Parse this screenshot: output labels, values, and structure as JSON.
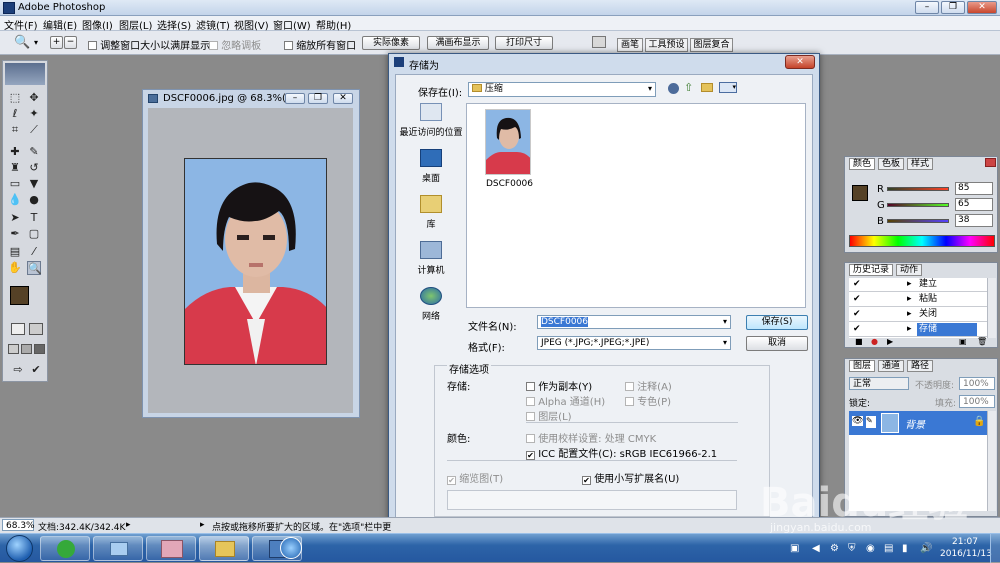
{
  "app": {
    "title": "Adobe Photoshop"
  },
  "menu": [
    "文件(F)",
    "编辑(E)",
    "图像(I)",
    "图层(L)",
    "选择(S)",
    "滤镜(T)",
    "视图(V)",
    "窗口(W)",
    "帮助(H)"
  ],
  "options": {
    "resize_windows": "调整窗口大小以满屏显示",
    "ignore_palettes": "忽略调板",
    "zoom_all": "缩放所有窗口",
    "actual_pixels": "实际像素",
    "fit_screen": "满画布显示",
    "print_size": "打印尺寸",
    "tabs": [
      "画笔",
      "工具预设",
      "图层复合"
    ]
  },
  "document": {
    "title": "DSCF0006.jpg @ 68.3%(R..."
  },
  "dialog": {
    "title": "存储为",
    "save_in_label": "保存在(I):",
    "save_in_value": "压缩",
    "places": [
      "最近访问的位置",
      "桌面",
      "库",
      "计算机",
      "网络"
    ],
    "file_thumb_name": "DSCF0006",
    "filename_label": "文件名(N):",
    "filename_value": "DSCF0006",
    "format_label": "格式(F):",
    "format_value": "JPEG (*.JPG;*.JPEG;*.JPE)",
    "save_btn": "保存(S)",
    "cancel_btn": "取消",
    "options_title": "存储选项",
    "store_label": "存储:",
    "as_copy": "作为副本(Y)",
    "annotations": "注释(A)",
    "alpha": "Alpha 通道(H)",
    "spot": "专色(P)",
    "layers": "图层(L)",
    "color_label": "颜色:",
    "proof": "使用校样设置: 处理 CMYK",
    "icc": "ICC 配置文件(C): sRGB IEC61966-2.1",
    "thumbnail": "缩览图(T)",
    "lowercase": "使用小写扩展名(U)"
  },
  "color_panel": {
    "tabs": [
      "颜色",
      "色板",
      "样式"
    ],
    "r_label": "R",
    "g_label": "G",
    "b_label": "B",
    "r": "85",
    "g": "65",
    "b": "38",
    "fg_color": "#554126"
  },
  "history_panel": {
    "tabs": [
      "历史记录",
      "动作"
    ],
    "items": [
      "建立",
      "粘贴",
      "关闭",
      "存储"
    ]
  },
  "layers_panel": {
    "tabs": [
      "图层",
      "通道",
      "路径"
    ],
    "blend": "正常",
    "opacity_label": "不透明度:",
    "opacity": "100%",
    "lock_label": "锁定:",
    "fill_label": "填充:",
    "fill": "100%",
    "layer_name": "背景"
  },
  "status": {
    "zoom": "68.3%",
    "doc": "文档:342.4K/342.4K",
    "hint": "点按或拖移所要扩大的区域。在\"选项\"栏中更"
  },
  "tray": {
    "time": "21:07",
    "date": "2016/11/13"
  },
  "watermark": {
    "text": "Baidu经验",
    "url": "jingyan.baidu.com"
  }
}
